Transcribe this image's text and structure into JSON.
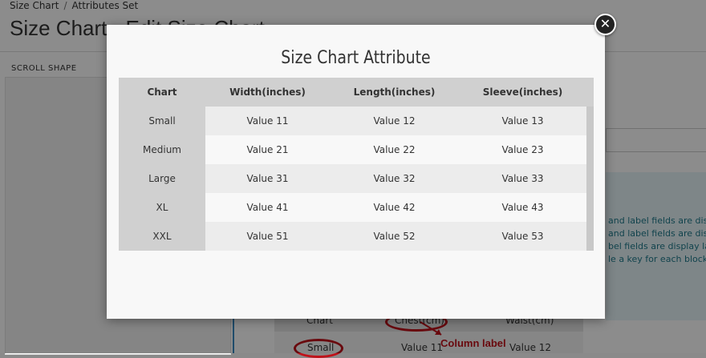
{
  "breadcrumb": {
    "items": [
      "Size Chart",
      "Attributes Set"
    ]
  },
  "page": {
    "title": "Size Chart - Edit Size Chart",
    "scroll_link": "SCROLL SHAPE"
  },
  "help": {
    "lines": [
      "and label fields are disp",
      "and label fields are disp",
      "bel fields are display lab",
      "le a key for each block."
    ]
  },
  "background_table": {
    "head_left": "Chart",
    "head_mid": "Chest(cm)",
    "head_right": "Waist(cm)",
    "row_label": "Small",
    "row_val1": "Value 11",
    "row_val2": "Value 12",
    "annotation": "Column label"
  },
  "modal": {
    "title": "Size Chart Attribute",
    "close_symbol": "✕",
    "headers": [
      "Chart",
      "Width(inches)",
      "Length(inches)",
      "Sleeve(inches)"
    ],
    "rows": [
      {
        "label": "Small",
        "values": [
          "Value 11",
          "Value 12",
          "Value 13"
        ]
      },
      {
        "label": "Medium",
        "values": [
          "Value 21",
          "Value 22",
          "Value 23"
        ]
      },
      {
        "label": "Large",
        "values": [
          "Value 31",
          "Value 32",
          "Value 33"
        ]
      },
      {
        "label": "XL",
        "values": [
          "Value 41",
          "Value 42",
          "Value 43"
        ]
      },
      {
        "label": "XXL",
        "values": [
          "Value 51",
          "Value 52",
          "Value 53"
        ]
      }
    ]
  },
  "colors": {
    "annotation_red": "#c0121a",
    "help_text": "#1f7a8c",
    "overlay": "rgba(0,0,0,0.45)"
  }
}
